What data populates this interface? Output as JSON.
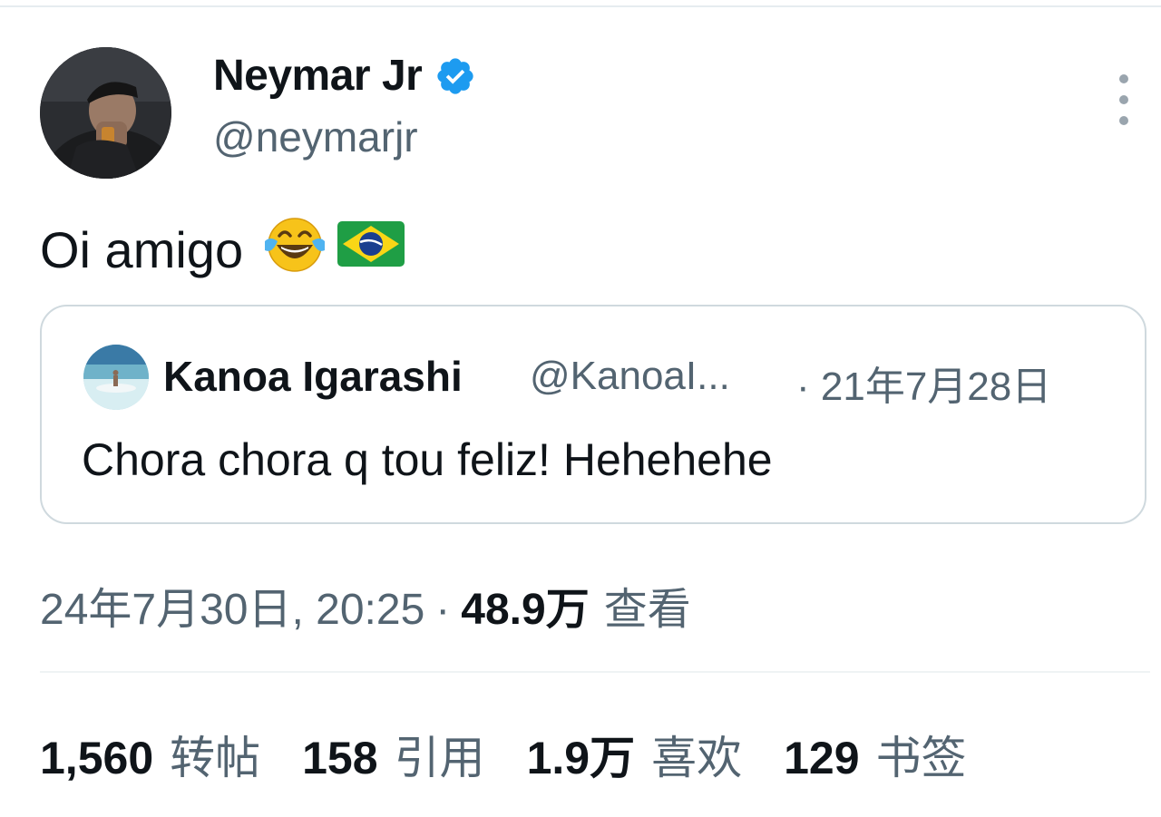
{
  "author": {
    "display_name": "Neymar Jr",
    "handle": "@neymarjr",
    "verified_icon": "verified-badge-icon",
    "verified_color": "#1d9bf0"
  },
  "tweet": {
    "text": "Oi amigo",
    "emojis": [
      "face-with-tears-of-joy",
      "brazil-flag"
    ]
  },
  "quoted_tweet": {
    "display_name": "Kanoa Igarashi",
    "handle": "@KanoaI...",
    "date": "· 21年7月28日",
    "text": "Chora chora q tou feliz! Hehehehe"
  },
  "meta": {
    "timestamp": "24年7月30日, 20:25",
    "separator": "·",
    "views_count": "48.9万",
    "views_label": "查看"
  },
  "stats": [
    {
      "count": "1,560",
      "label": "转帖"
    },
    {
      "count": "158",
      "label": "引用"
    },
    {
      "count": "1.9万",
      "label": "喜欢"
    },
    {
      "count": "129",
      "label": "书签"
    }
  ],
  "colors": {
    "text_primary": "#0f1419",
    "text_secondary": "#536471",
    "border": "#cfd9de"
  }
}
